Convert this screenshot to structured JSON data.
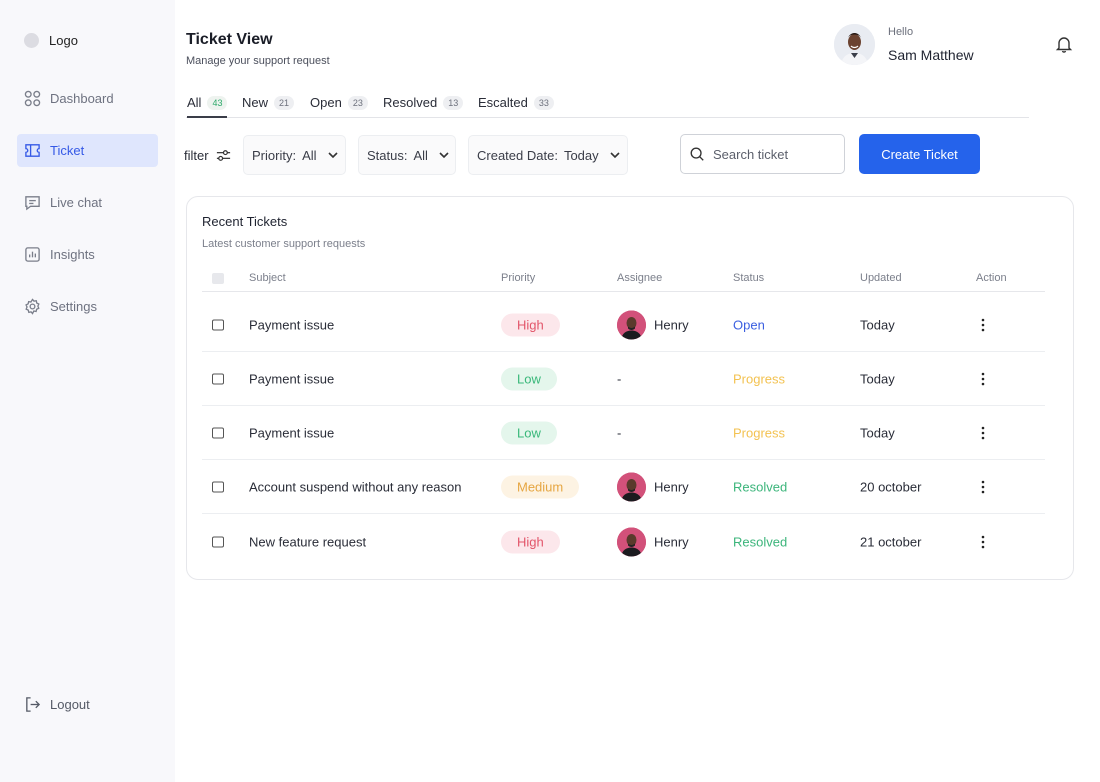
{
  "sidebar": {
    "logo": "Logo",
    "items": [
      {
        "label": "Dashboard",
        "icon": "dashboard-icon"
      },
      {
        "label": "Ticket",
        "icon": "ticket-icon",
        "active": true
      },
      {
        "label": "Live chat",
        "icon": "chat-icon"
      },
      {
        "label": "Insights",
        "icon": "insights-icon"
      },
      {
        "label": "Settings",
        "icon": "gear-icon"
      }
    ],
    "logout": "Logout"
  },
  "header": {
    "title": "Ticket View",
    "subtitle": "Manage your support request",
    "greeting": "Hello",
    "user_name": "Sam Matthew"
  },
  "tabs": [
    {
      "label": "All",
      "count": "43",
      "active": true
    },
    {
      "label": "New",
      "count": "21"
    },
    {
      "label": "Open",
      "count": "23"
    },
    {
      "label": "Resolved",
      "count": "13"
    },
    {
      "label": "Escalted",
      "count": "33"
    }
  ],
  "filters": {
    "label": "filter",
    "priority_label": "Priority:",
    "priority_value": "All",
    "status_label": "Status:",
    "status_value": "All",
    "date_label": "Created Date:",
    "date_value": "Today"
  },
  "search": {
    "placeholder": "Search ticket"
  },
  "create_button": "Create Ticket",
  "table": {
    "title": "Recent Tickets",
    "subtitle": "Latest customer support requests",
    "columns": [
      "Subject",
      "Priority",
      "Assignee",
      "Status",
      "Updated",
      "Action"
    ],
    "rows": [
      {
        "subject": "Payment issue",
        "priority": "High",
        "assignee": "Henry",
        "status": "Open",
        "updated": "Today"
      },
      {
        "subject": "Payment issue",
        "priority": "Low",
        "assignee": "-",
        "status": "Progress",
        "updated": "Today"
      },
      {
        "subject": "Payment issue",
        "priority": "Low",
        "assignee": "-",
        "status": "Progress",
        "updated": "Today"
      },
      {
        "subject": "Account suspend without any reason",
        "priority": "Medium",
        "assignee": "Henry",
        "status": "Resolved",
        "updated": "20 october"
      },
      {
        "subject": "New feature request",
        "priority": "High",
        "assignee": "Henry",
        "status": "Resolved",
        "updated": "21 october"
      }
    ]
  },
  "colors": {
    "accent": "#2563eb",
    "active_nav_bg": "#dfe6fd",
    "priority_high": "#e25569",
    "priority_low": "#39b87a",
    "priority_medium": "#e6a642",
    "status_open": "#3b5fe0",
    "status_progress": "#f3c251",
    "status_resolved": "#3cb57b"
  }
}
